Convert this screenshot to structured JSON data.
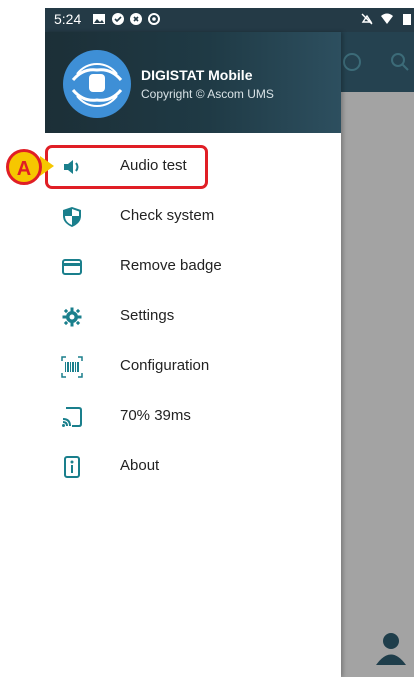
{
  "status_bar": {
    "time": "5:24"
  },
  "drawer": {
    "app_name": "DIGISTAT Mobile",
    "copyright": "Copyright © Ascom UMS",
    "items": [
      {
        "label": "Audio test",
        "icon": "speaker-icon"
      },
      {
        "label": "Check system",
        "icon": "shield-icon"
      },
      {
        "label": "Remove badge",
        "icon": "card-icon"
      },
      {
        "label": "Settings",
        "icon": "gear-icon"
      },
      {
        "label": "Configuration",
        "icon": "barcode-scan-icon"
      },
      {
        "label": "70% 39ms",
        "icon": "cast-signal-icon"
      },
      {
        "label": "About",
        "icon": "info-icon"
      }
    ]
  },
  "annotation": {
    "marker_label": "A"
  },
  "colors": {
    "accent": "#1a7f8c",
    "header": "#243a46",
    "highlight": "#e01e25",
    "marker": "#f6c700"
  }
}
